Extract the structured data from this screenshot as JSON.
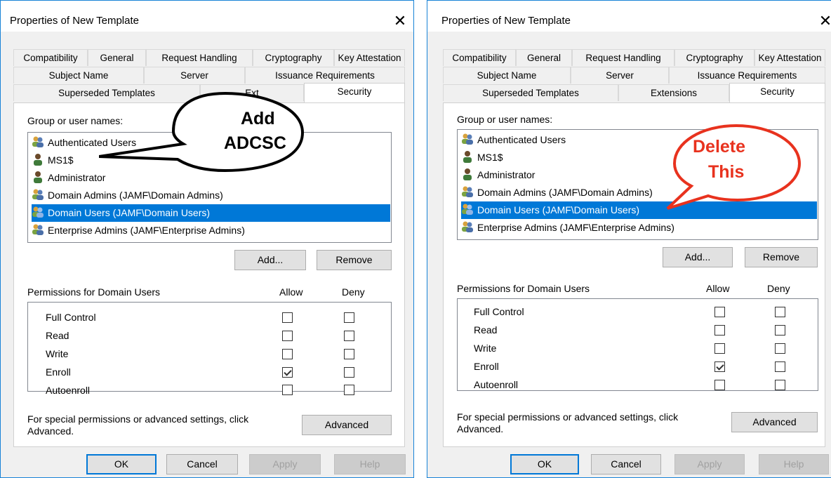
{
  "dialog_title": "Properties of New Template",
  "close_glyph": "✕",
  "tabs": {
    "row1": [
      "Compatibility",
      "General",
      "Request Handling",
      "Cryptography",
      "Key Attestation"
    ],
    "row2": [
      "Subject Name",
      "Server",
      "Issuance Requirements"
    ],
    "row3": [
      "Superseded Templates",
      "Extensions",
      "Security"
    ],
    "left_row3": [
      "Superseded Templates",
      "Ext",
      "Security"
    ],
    "active": "Security"
  },
  "group_label": "Group or user names:",
  "users": [
    {
      "name": "Authenticated Users",
      "icon": "group-users-icon"
    },
    {
      "name": "MS1$",
      "icon": "computer-user-icon"
    },
    {
      "name": "Administrator",
      "icon": "user-icon"
    },
    {
      "name": "Domain Admins (JAMF\\Domain Admins)",
      "icon": "group-users-icon"
    },
    {
      "name": "Domain Users (JAMF\\Domain Users)",
      "icon": "group-users-icon",
      "selected": true
    },
    {
      "name": "Enterprise Admins (JAMF\\Enterprise Admins)",
      "icon": "group-users-icon"
    }
  ],
  "buttons": {
    "add": "Add...",
    "remove": "Remove",
    "advanced": "Advanced",
    "ok": "OK",
    "cancel": "Cancel",
    "apply": "Apply",
    "help": "Help"
  },
  "permissions": {
    "label": "Permissions for Domain Users",
    "allow": "Allow",
    "deny": "Deny",
    "rows": [
      {
        "name": "Full Control",
        "allow": false,
        "deny": false
      },
      {
        "name": "Read",
        "allow": false,
        "deny": false
      },
      {
        "name": "Write",
        "allow": false,
        "deny": false
      },
      {
        "name": "Enroll",
        "allow": true,
        "deny": false
      },
      {
        "name": "Autoenroll",
        "allow": false,
        "deny": false
      }
    ]
  },
  "special_text": {
    "line1": "For special permissions or advanced settings, click",
    "line2": "Advanced."
  },
  "annotations": {
    "left": {
      "line1": "Add",
      "line2": "ADCSC"
    },
    "right": {
      "line1": "Delete",
      "line2": "This"
    }
  },
  "colors": {
    "accent": "#0078d7",
    "selection": "#0078d7",
    "callout_red": "#e8321e",
    "window_border": "#1883d7"
  }
}
